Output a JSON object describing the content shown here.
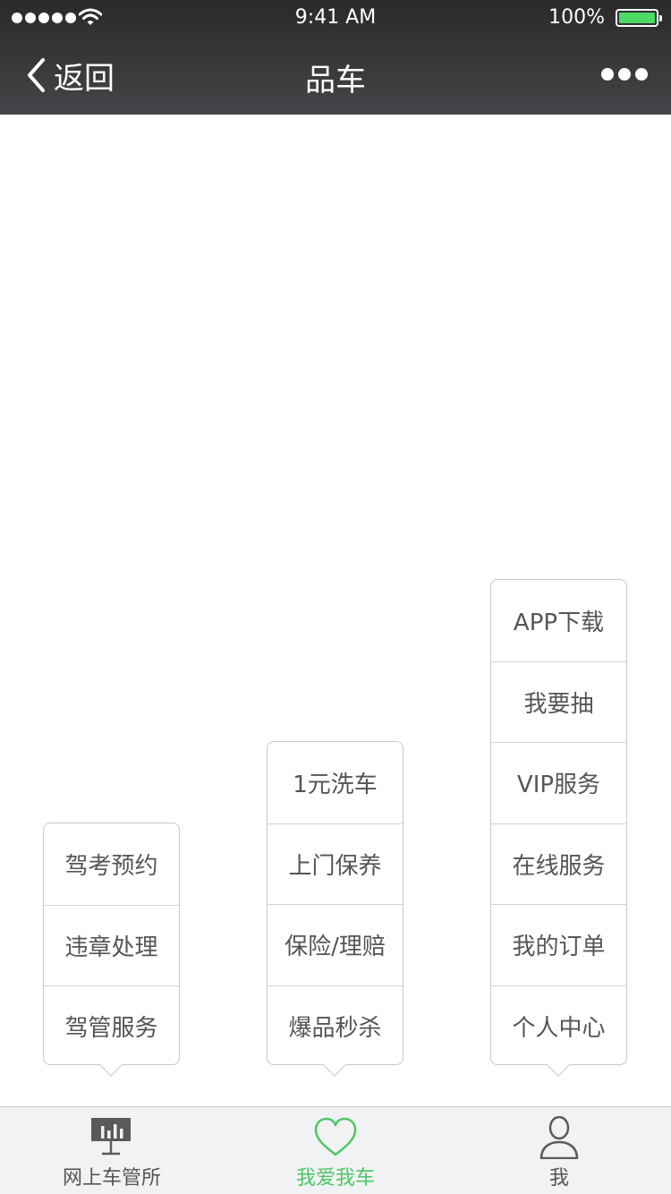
{
  "status_bar": {
    "time": "9:41 AM",
    "battery_percent": "100%",
    "battery_level": 1.0,
    "signal_icon": "signal-dots-icon",
    "wifi_icon": "wifi-icon"
  },
  "nav": {
    "back_label": "返回",
    "back_icon": "chevron-left-icon",
    "title": "品车",
    "more_icon": "more-dots-icon"
  },
  "menus": {
    "left": [
      "驾考预约",
      "违章处理",
      "驾管服务"
    ],
    "middle": [
      "1元洗车",
      "上门保养",
      "保险/理赔",
      "爆品秒杀"
    ],
    "right": [
      "APP下载",
      "我要抽",
      "VIP服务",
      "在线服务",
      "我的订单",
      "个人中心"
    ]
  },
  "tabs": [
    {
      "label": "网上车管所",
      "icon": "presentation-chart-icon",
      "active": false
    },
    {
      "label": "我爱我车",
      "icon": "heart-icon",
      "active": true
    },
    {
      "label": "我",
      "icon": "person-icon",
      "active": false
    }
  ],
  "colors": {
    "header_bg": "#38383b",
    "active_tab": "#4cc764",
    "battery": "#4cd964",
    "menu_text": "#555555"
  }
}
